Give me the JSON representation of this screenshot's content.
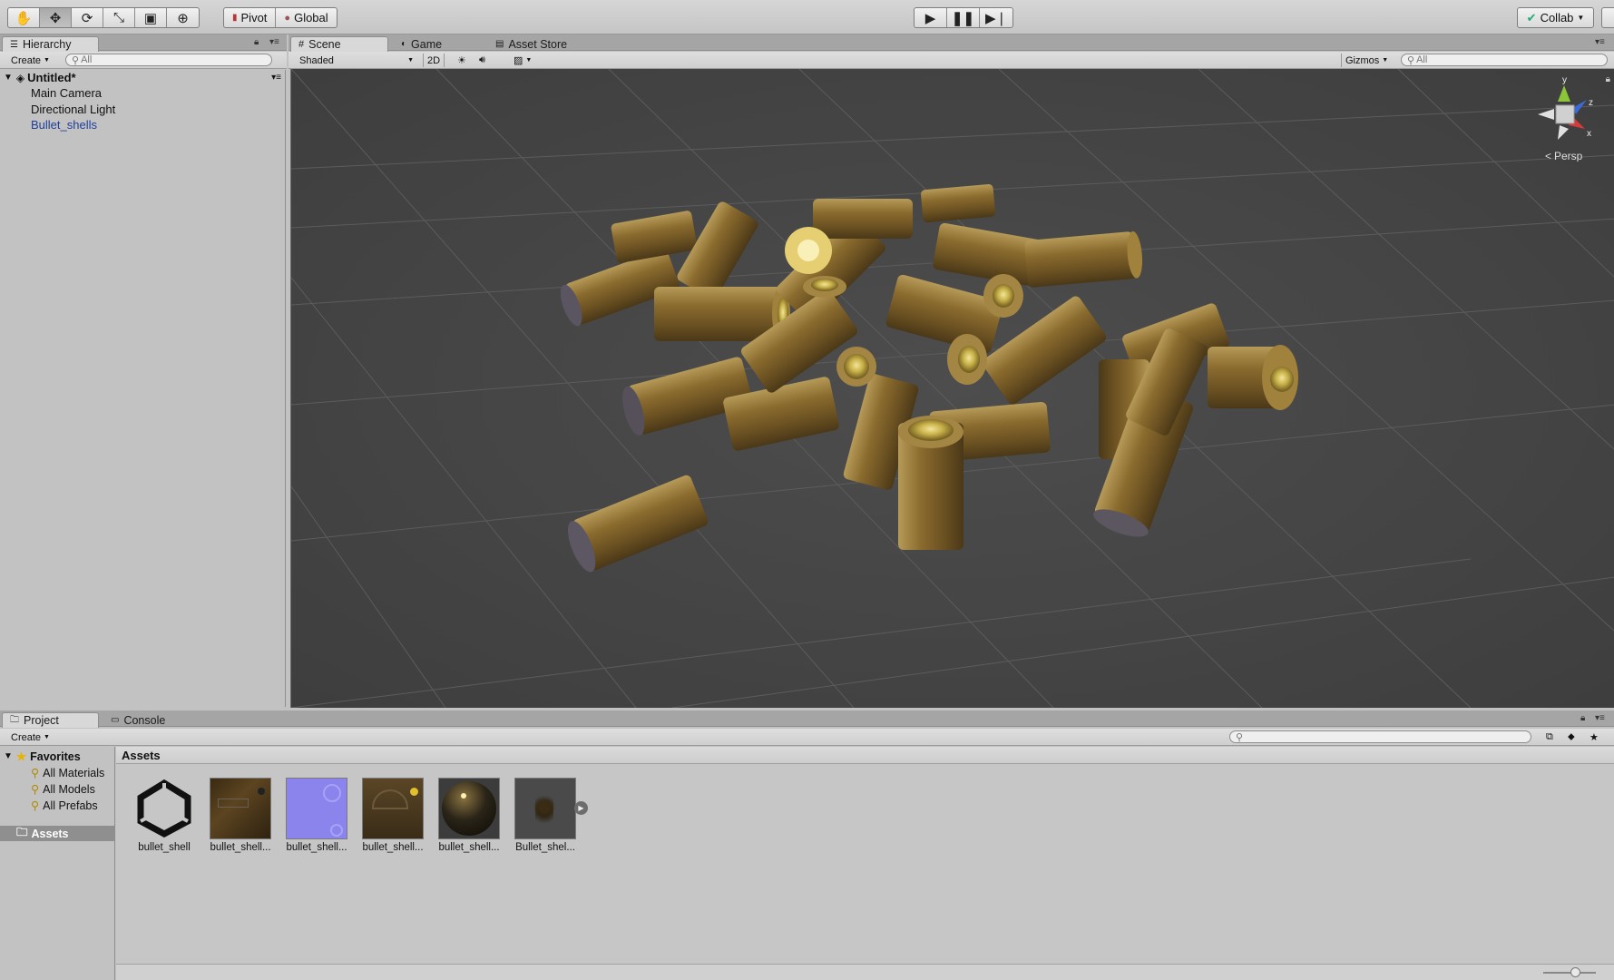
{
  "toolbar": {
    "tools": [
      "hand-icon",
      "move-icon",
      "rotate-icon",
      "scale-icon",
      "rect-tool-icon",
      "transform-icon"
    ],
    "pivot_label": "Pivot",
    "global_label": "Global",
    "collab_label": "Collab"
  },
  "hierarchy": {
    "tab_label": "Hierarchy",
    "create_label": "Create",
    "search_placeholder": "All",
    "scene_name": "Untitled*",
    "items": [
      "Main Camera",
      "Directional Light",
      "Bullet_shells"
    ],
    "selected_item": "Bullet_shells"
  },
  "scene": {
    "tabs": [
      "Scene",
      "Game",
      "Asset Store"
    ],
    "shading_mode": "Shaded",
    "mode_2d_label": "2D",
    "gizmos_label": "Gizmos",
    "search_placeholder": "All",
    "projection_label": "Persp",
    "axis_labels": {
      "y": "y",
      "z": "z",
      "x": "x"
    }
  },
  "project": {
    "tabs": [
      "Project",
      "Console"
    ],
    "create_label": "Create",
    "favorites_label": "Favorites",
    "favorites": [
      "All Materials",
      "All Models",
      "All Prefabs"
    ],
    "assets_folder": "Assets",
    "breadcrumb": "Assets",
    "assets": [
      {
        "label": "bullet_shell",
        "kind": "unity-logo"
      },
      {
        "label": "bullet_shell...",
        "kind": "albedo-texture"
      },
      {
        "label": "bullet_shell...",
        "kind": "normal-map"
      },
      {
        "label": "bullet_shell...",
        "kind": "metallic-texture"
      },
      {
        "label": "bullet_shell...",
        "kind": "material-sphere"
      },
      {
        "label": "Bullet_shel...",
        "kind": "prefab"
      }
    ]
  },
  "colors": {
    "selection_text": "#1f3f9a",
    "scene_bg": "#474747",
    "panel_bg": "#c2c2c2",
    "brass": "#8a6b2e"
  }
}
